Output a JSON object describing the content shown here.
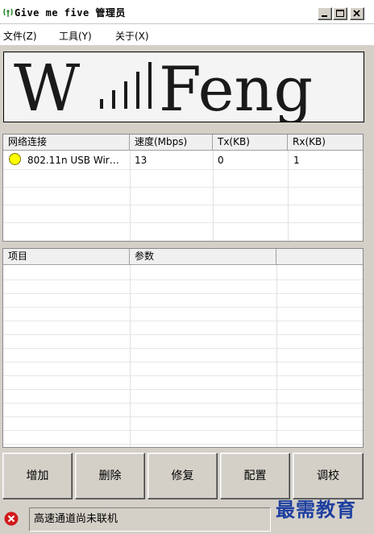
{
  "window": {
    "title": "Give me five 管理员"
  },
  "menu": [
    "文件(Z)",
    "工具(Y)",
    "关于(X)"
  ],
  "logo": {
    "text_left": "W",
    "text_right": "Feng"
  },
  "connections": {
    "columns": [
      "网络连接",
      "速度(Mbps)",
      "Tx(KB)",
      "Rx(KB)"
    ],
    "rows": [
      {
        "name": "802.11n USB Wir…",
        "speed": "13",
        "tx": "0",
        "rx": "1",
        "status_color": "#ffff00"
      }
    ]
  },
  "details": {
    "columns": [
      "项目",
      "参数",
      ""
    ]
  },
  "buttons": [
    "增加",
    "删除",
    "修复",
    "配置",
    "调校"
  ],
  "status": {
    "text": "高速通道尚未联机",
    "icon": "error-icon"
  },
  "watermark": "最需教育"
}
